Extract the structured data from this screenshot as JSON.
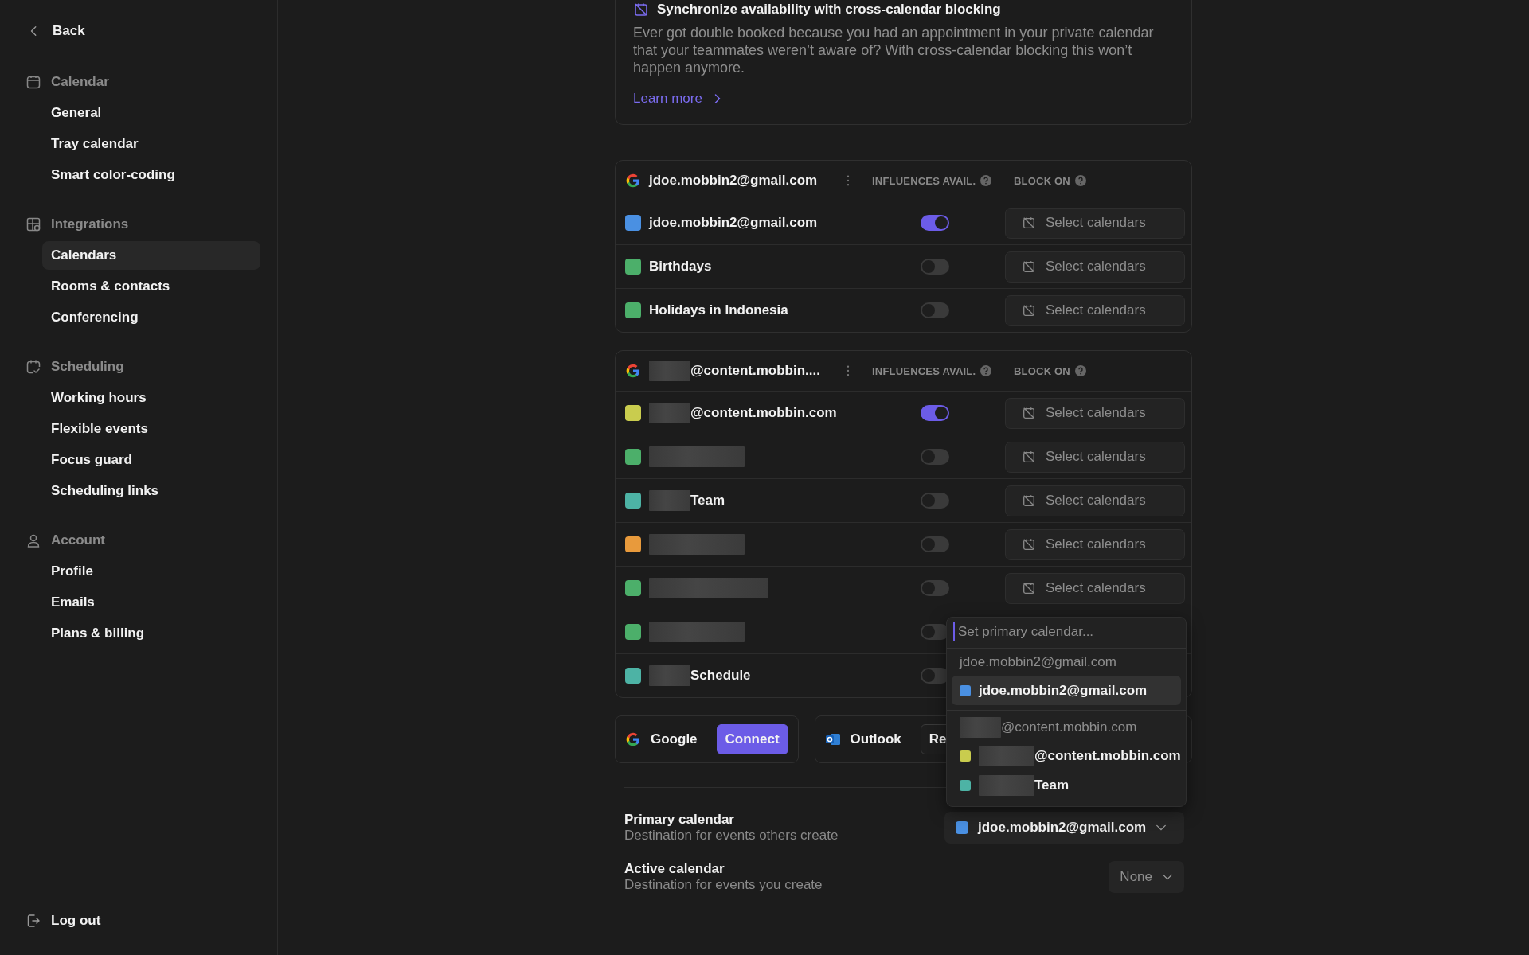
{
  "sidebar": {
    "back": "Back",
    "sections": [
      {
        "title": "Calendar",
        "items": [
          {
            "label": "General",
            "selected": false
          },
          {
            "label": "Tray calendar",
            "selected": false
          },
          {
            "label": "Smart color-coding",
            "selected": false
          }
        ]
      },
      {
        "title": "Integrations",
        "items": [
          {
            "label": "Calendars",
            "selected": true
          },
          {
            "label": "Rooms & contacts",
            "selected": false
          },
          {
            "label": "Conferencing",
            "selected": false
          }
        ]
      },
      {
        "title": "Scheduling",
        "items": [
          {
            "label": "Working hours",
            "selected": false
          },
          {
            "label": "Flexible events",
            "selected": false
          },
          {
            "label": "Focus guard",
            "selected": false
          },
          {
            "label": "Scheduling links",
            "selected": false
          }
        ]
      },
      {
        "title": "Account",
        "items": [
          {
            "label": "Profile",
            "selected": false
          },
          {
            "label": "Emails",
            "selected": false
          },
          {
            "label": "Plans & billing",
            "selected": false
          }
        ]
      }
    ],
    "logout": "Log out"
  },
  "banner": {
    "title": "Synchronize availability with cross-calendar blocking",
    "text": "Ever got double booked because you had an appointment in your private calendar that your teammates weren’t aware of? With cross-calendar blocking this won’t happen anymore.",
    "link": "Learn more"
  },
  "accounts": [
    {
      "email": "jdoe.mobbin2@gmail.com",
      "redacted": false,
      "columns": [
        "INFLUENCES AVAIL.",
        "BLOCK ON"
      ],
      "calendars": [
        {
          "color": "#4a90e2",
          "name": "jdoe.mobbin2@gmail.com",
          "redacted": false,
          "on": true,
          "action": "Select calendars"
        },
        {
          "color": "#4caf6a",
          "name": "Birthdays",
          "redacted": false,
          "on": false,
          "action": "Select calendars"
        },
        {
          "color": "#4caf6a",
          "name": "Holidays in Indonesia",
          "redacted": false,
          "on": false,
          "action": "Select calendars"
        }
      ]
    },
    {
      "email": "@content.mobbin....",
      "redacted": true,
      "columns": [
        "INFLUENCES AVAIL.",
        "BLOCK ON"
      ],
      "calendars": [
        {
          "color": "#c9cc4e",
          "name": "@content.mobbin.com",
          "redacted": true,
          "on": true,
          "action": "Select calendars"
        },
        {
          "color": "#4caf6a",
          "redacted": true,
          "on": false,
          "action": "Select calendars"
        },
        {
          "color": "#4db3a5",
          "name": "Team",
          "redacted": true,
          "on": false,
          "action": "Select calendars"
        },
        {
          "color": "#e89a3c",
          "redacted": true,
          "on": false,
          "action": "Select calendars"
        },
        {
          "color": "#4caf6a",
          "redacted": true,
          "on": false,
          "action": "Select calendars"
        },
        {
          "color": "#4caf6a",
          "redacted": true,
          "on": false
        },
        {
          "color": "#4db3a5",
          "name": "Schedule",
          "redacted": true,
          "on": false
        }
      ]
    }
  ],
  "providers": [
    {
      "kind": "google",
      "name": "Google",
      "button": "Connect",
      "primary": true
    },
    {
      "kind": "outlook",
      "name": "Outlook",
      "button": "Re",
      "primary": false
    }
  ],
  "settings": [
    {
      "label": "Primary calendar",
      "description": "Destination for events others create",
      "value": "jdoe.mobbin2@gmail.com",
      "color": "#4a90e2"
    },
    {
      "label": "Active calendar",
      "description": "Destination for events you create",
      "value": "None"
    }
  ],
  "popover": {
    "placeholder": "Set primary calendar...",
    "groups": [
      {
        "label": "jdoe.mobbin2@gmail.com",
        "redacted": false,
        "items": [
          {
            "name": "jdoe.mobbin2@gmail.com",
            "redacted": false,
            "color": "#4a90e2",
            "selected": true
          }
        ]
      },
      {
        "label": "@content.mobbin.com",
        "redacted": true,
        "items": [
          {
            "name": "@content.mobbin.com",
            "redacted": true,
            "color": "#c9cc4e",
            "selected": false
          },
          {
            "name": "Team",
            "redacted": true,
            "color": "#4db3a5",
            "selected": false
          }
        ]
      }
    ]
  }
}
